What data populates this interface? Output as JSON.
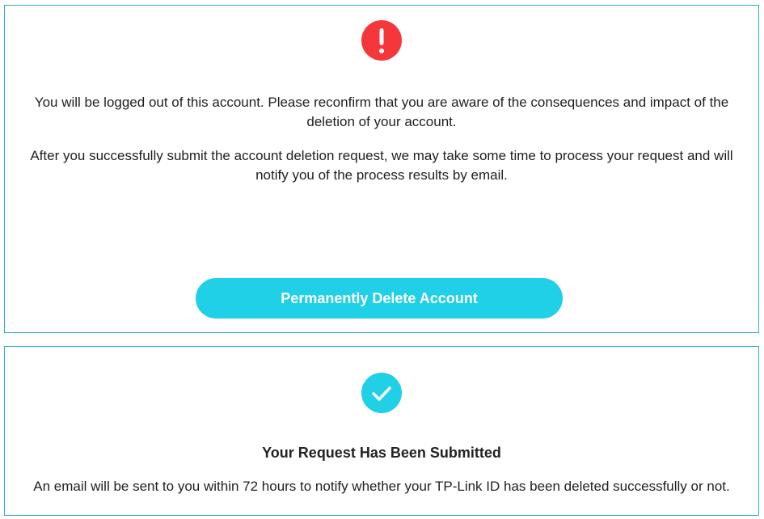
{
  "colors": {
    "accent": "#1fd0e6",
    "warning": "#f5363a",
    "panel_border": "#29a9d6"
  },
  "confirm_panel": {
    "icon": "exclamation-icon",
    "paragraph_1": "You will be logged out of this account. Please reconfirm that you are aware of the consequences and impact of the deletion of your account.",
    "paragraph_2": "After you successfully submit the account deletion request, we may take some time to process your request and will notify you of the process results by email.",
    "delete_button_label": "Permanently Delete Account"
  },
  "success_panel": {
    "icon": "checkmark-icon",
    "title": "Your Request Has Been Submitted",
    "message": "An email will be sent to you within 72 hours to notify whether your TP-Link ID has been deleted successfully or not."
  }
}
